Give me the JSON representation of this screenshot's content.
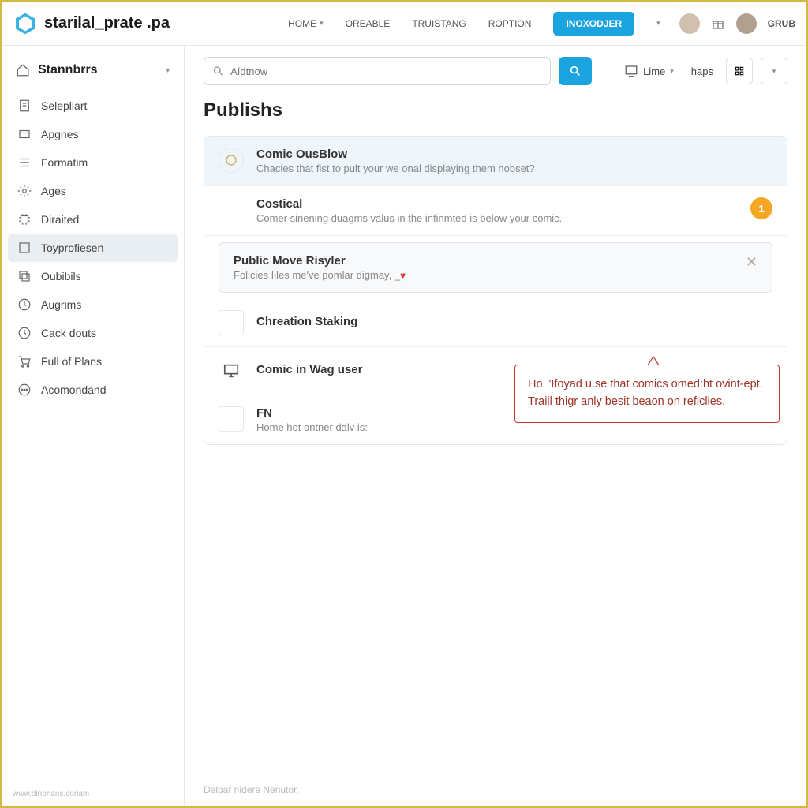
{
  "header": {
    "logo_text": "starilal_prate .pa",
    "nav": [
      "HOME",
      "OREABLE",
      "TRUISTANG",
      "ROPTION"
    ],
    "cta": "INOXODJER",
    "grub": "GRUB"
  },
  "sidebar": {
    "title": "Stannbrrs",
    "items": [
      {
        "label": "Selepliart",
        "icon": "doc"
      },
      {
        "label": "Apgnes",
        "icon": "card"
      },
      {
        "label": "Formatim",
        "icon": "list"
      },
      {
        "label": "Ages",
        "icon": "gear"
      },
      {
        "label": "Diraited",
        "icon": "chip"
      },
      {
        "label": "Toyprofiesen",
        "icon": "box",
        "active": true
      },
      {
        "label": "Oubibils",
        "icon": "stack"
      },
      {
        "label": "Augrims",
        "icon": "clock"
      },
      {
        "label": "Cack douts",
        "icon": "clock2"
      },
      {
        "label": "Full of Plans",
        "icon": "cart"
      },
      {
        "label": "Acomondand",
        "icon": "dots"
      }
    ]
  },
  "toolbar": {
    "search_placeholder": "Aídtnow",
    "lime": "Lime",
    "haps": "haps"
  },
  "page": {
    "title": "Publishs",
    "rows": [
      {
        "title": "Comic OusBlow",
        "desc": "Chacies that fist to pult your we onal displaying them nobset?",
        "icon": "ring"
      },
      {
        "title": "Costical",
        "desc": "Comer sinening duagms valus in the infinmted is below your comic.",
        "badge": "1"
      },
      {
        "title": "Public Move Risyler",
        "desc": "Folicies Iiles me've pomlar digmay, _",
        "heart": "♥",
        "closable": true,
        "inset": true
      },
      {
        "title": "Chreation Staking",
        "icon": "square"
      },
      {
        "title": "Comic in Wag user",
        "icon": "monitor"
      },
      {
        "title": "FN",
        "desc": "Home hot ontner dalv is:",
        "icon": "square"
      }
    ],
    "callout": "Ho. 'Ifoyad u.se that comics omed:ht ovint-ept. Traill thigr anly besit beaon on reficlies.",
    "footer": "Delpar nidere Nenutor.",
    "host": "www.dinbhans.coriam"
  }
}
